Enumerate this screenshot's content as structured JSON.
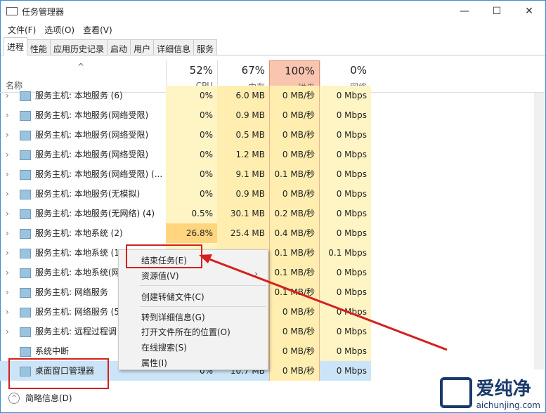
{
  "window": {
    "title": "任务管理器",
    "minimize": "—",
    "maximize": "☐",
    "close": "✕"
  },
  "menubar": [
    "文件(F)",
    "选项(O)",
    "查看(V)"
  ],
  "tabs": [
    "进程",
    "性能",
    "应用历史记录",
    "启动",
    "用户",
    "详细信息",
    "服务"
  ],
  "header": {
    "name": "名称",
    "cpu_pct": "52%",
    "cpu": "CPU",
    "mem_pct": "67%",
    "mem": "内存",
    "disk_pct": "100%",
    "disk": "磁盘",
    "net_pct": "0%",
    "net": "网络"
  },
  "rows": [
    {
      "name": "服务主机: 本地服务 (6)",
      "cpu": "0%",
      "mem": "6.0 MB",
      "disk": "0 MB/秒",
      "net": "0 Mbps"
    },
    {
      "name": "服务主机: 本地服务(网络受限)",
      "cpu": "0%",
      "mem": "0.9 MB",
      "disk": "0 MB/秒",
      "net": "0 Mbps"
    },
    {
      "name": "服务主机: 本地服务(网络受限)",
      "cpu": "0%",
      "mem": "0.5 MB",
      "disk": "0 MB/秒",
      "net": "0 Mbps"
    },
    {
      "name": "服务主机: 本地服务(网络受限)",
      "cpu": "0%",
      "mem": "1.2 MB",
      "disk": "0 MB/秒",
      "net": "0 Mbps"
    },
    {
      "name": "服务主机: 本地服务(网络受限) (...",
      "cpu": "0%",
      "mem": "9.1 MB",
      "disk": "0.1 MB/秒",
      "net": "0 Mbps"
    },
    {
      "name": "服务主机: 本地服务(无模拟)",
      "cpu": "0%",
      "mem": "0.9 MB",
      "disk": "0 MB/秒",
      "net": "0 Mbps"
    },
    {
      "name": "服务主机: 本地服务(无网络) (4)",
      "cpu": "0.5%",
      "mem": "30.1 MB",
      "disk": "0.2 MB/秒",
      "net": "0 Mbps"
    },
    {
      "name": "服务主机: 本地系统 (2)",
      "cpu": "26.8%",
      "mem": "25.4 MB",
      "disk": "0.4 MB/秒",
      "net": "0 Mbps"
    },
    {
      "name": "服务主机: 本地系统 (1",
      "cpu": "",
      "mem": "",
      "disk": "0.1 MB/秒",
      "net": "0.1 Mbps"
    },
    {
      "name": "服务主机: 本地系统(网",
      "cpu": "",
      "mem": "",
      "disk": "0.1 MB/秒",
      "net": "0 Mbps"
    },
    {
      "name": "服务主机: 网络服务",
      "cpu": "",
      "mem": "",
      "disk": "0.1 MB/秒",
      "net": "0 Mbps"
    },
    {
      "name": "服务主机: 网络服务 (5",
      "cpu": "",
      "mem": "",
      "disk": "0 MB/秒",
      "net": "0 Mbps"
    },
    {
      "name": "服务主机: 远程过程调",
      "cpu": "",
      "mem": "",
      "disk": "0 MB/秒",
      "net": "0 Mbps"
    },
    {
      "name": "系统中断",
      "cpu": "",
      "mem": "",
      "disk": "0 MB/秒",
      "net": "0 Mbps"
    },
    {
      "name": "桌面窗口管理器",
      "cpu": "0%",
      "mem": "10.7 MB",
      "disk": "0 MB/秒",
      "net": "0 Mbps"
    }
  ],
  "context_menu": {
    "end_task": "结束任务(E)",
    "resource_values": "资源值(V)",
    "create_dump": "创建转储文件(C)",
    "go_to_details": "转到详细信息(G)",
    "open_location": "打开文件所在的位置(O)",
    "search_online": "在线搜索(S)",
    "properties": "属性(I)",
    "submenu_arrow": "›"
  },
  "footer": {
    "fewer_details": "简略信息(D)"
  },
  "watermark": {
    "name": "爱纯净",
    "url": "aichunjing.com"
  },
  "colors": {
    "accent": "#3c8dd8",
    "annotation": "#d42020",
    "disk_header": "#f9c5b0"
  }
}
